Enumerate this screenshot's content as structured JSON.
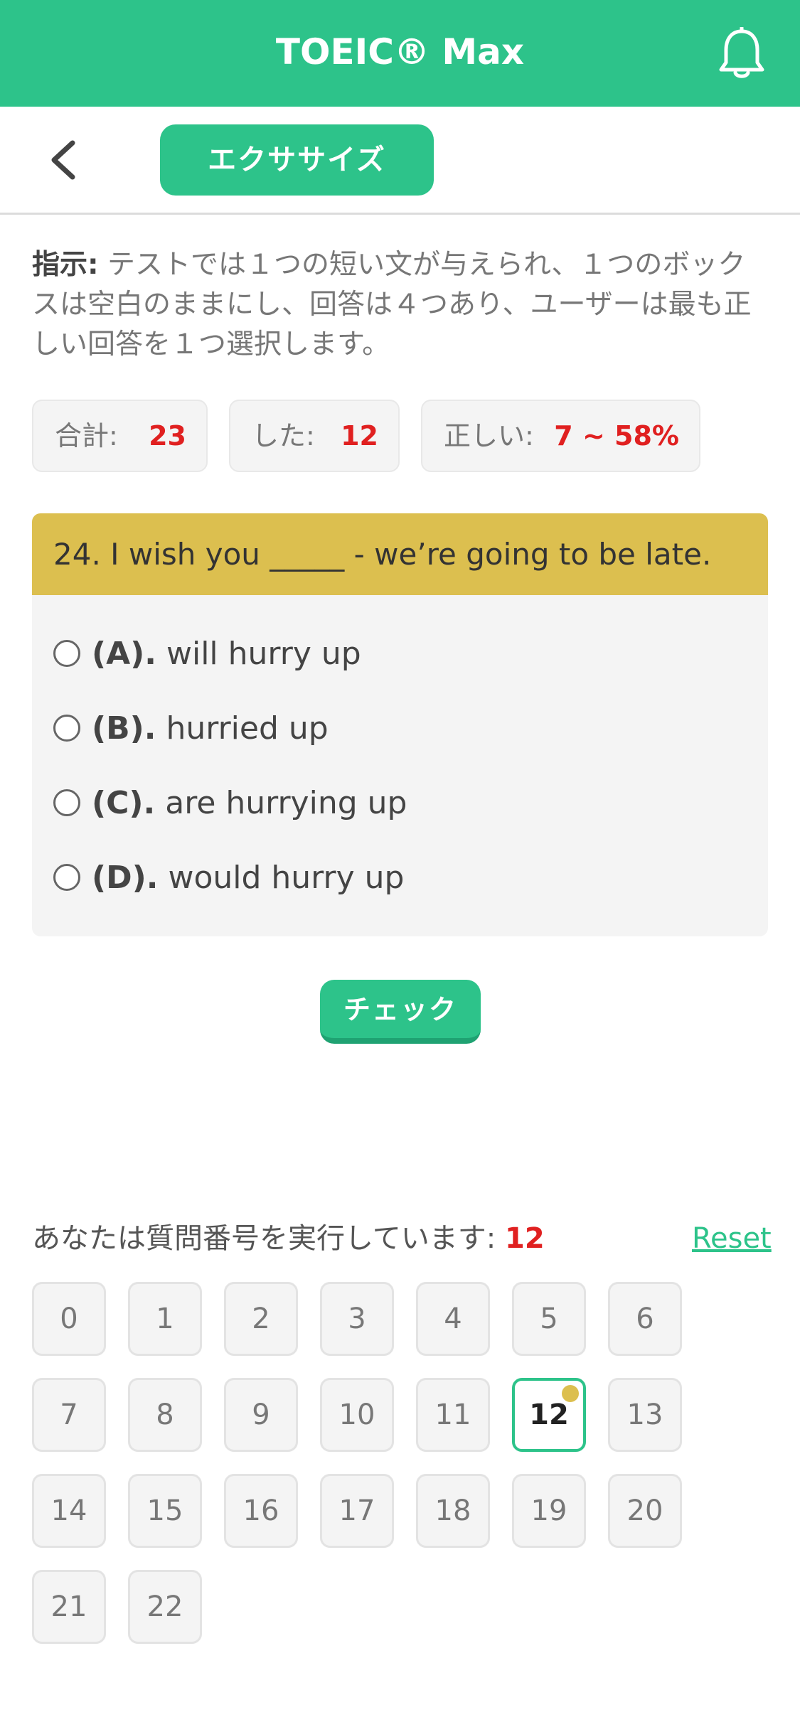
{
  "app": {
    "title": "TOEIC® Max"
  },
  "nav": {
    "section_button": "エクササイズ"
  },
  "instructions": {
    "label": "指示:",
    "text": " テストでは１つの短い文が与えられ、１つのボックスは空白のままにし、回答は４つあり、ユーザーは最も正しい回答を１つ選択します。"
  },
  "stats": {
    "total_label": "合計:",
    "total_value": "23",
    "done_label": "した:",
    "done_value": "12",
    "correct_label": "正しい:",
    "correct_value": "7 ~ 58%"
  },
  "question": {
    "text": "24. I wish you _____ - we’re going to be late.",
    "options": [
      {
        "letter": "(A).",
        "text": "will hurry up"
      },
      {
        "letter": "(B).",
        "text": "hurried up"
      },
      {
        "letter": "(C).",
        "text": "are hurrying up"
      },
      {
        "letter": "(D).",
        "text": "would hurry up"
      }
    ]
  },
  "check_button": "チェック",
  "progress": {
    "label": "あなたは質問番号を実行しています:",
    "current": "12",
    "reset": "Reset"
  },
  "question_numbers": [
    "0",
    "1",
    "2",
    "3",
    "4",
    "5",
    "6",
    "7",
    "8",
    "9",
    "10",
    "11",
    "12",
    "13",
    "14",
    "15",
    "16",
    "17",
    "18",
    "19",
    "20",
    "21",
    "22"
  ],
  "colors": {
    "accent": "#2dc38a",
    "question_header": "#dcbf4f",
    "highlight": "#e02020"
  }
}
